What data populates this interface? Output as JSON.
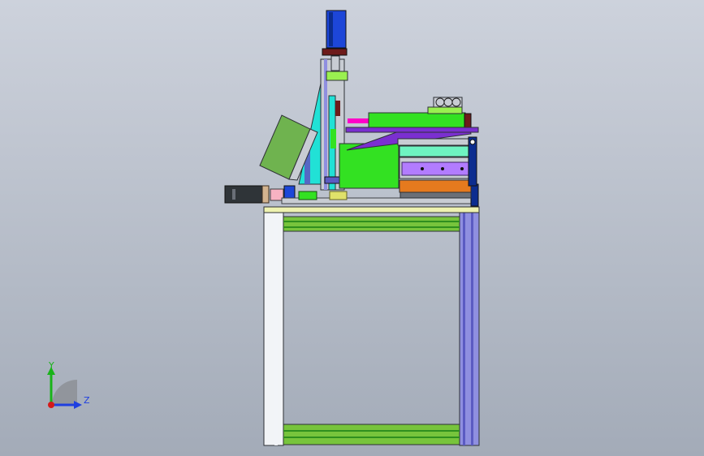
{
  "viewport": {
    "background_top": "#cdd2dc",
    "background_bottom": "#a3abb8",
    "model_name": "cad-machine-side-view"
  },
  "triad": {
    "y_label": "Y",
    "z_label": "Z",
    "y_color": "#19b319",
    "z_color": "#1f3fe0",
    "origin_color": "#d41a1a"
  },
  "colors": {
    "frame_white": "#f2f4f7",
    "frame_purple": "#8f8fe0",
    "frame_purple_dark": "#5b5bc2",
    "frame_green": "#77c43c",
    "frame_green_dark": "#2f8f1f",
    "table_yellow": "#eef2b0",
    "motor_blue": "#1d46d8",
    "motor_dark": "#0c2d8f",
    "cyan": "#21e1d6",
    "bright_green": "#33e122",
    "green_dark": "#1f8a17",
    "lime": "#9af050",
    "olive": "#6fb34f",
    "purple": "#7b2fd0",
    "purple_light": "#b27cff",
    "magenta": "#ff00c8",
    "orange": "#e57a1e",
    "maroon": "#6d1b1b",
    "gray_dark": "#2f3438",
    "gray_mid": "#6a6f77",
    "gray_light": "#c8ccd3",
    "pink": "#f7b2c2",
    "teal": "#6ef3c1",
    "tan": "#d3b38f",
    "yellow_green": "#dfe16a"
  }
}
